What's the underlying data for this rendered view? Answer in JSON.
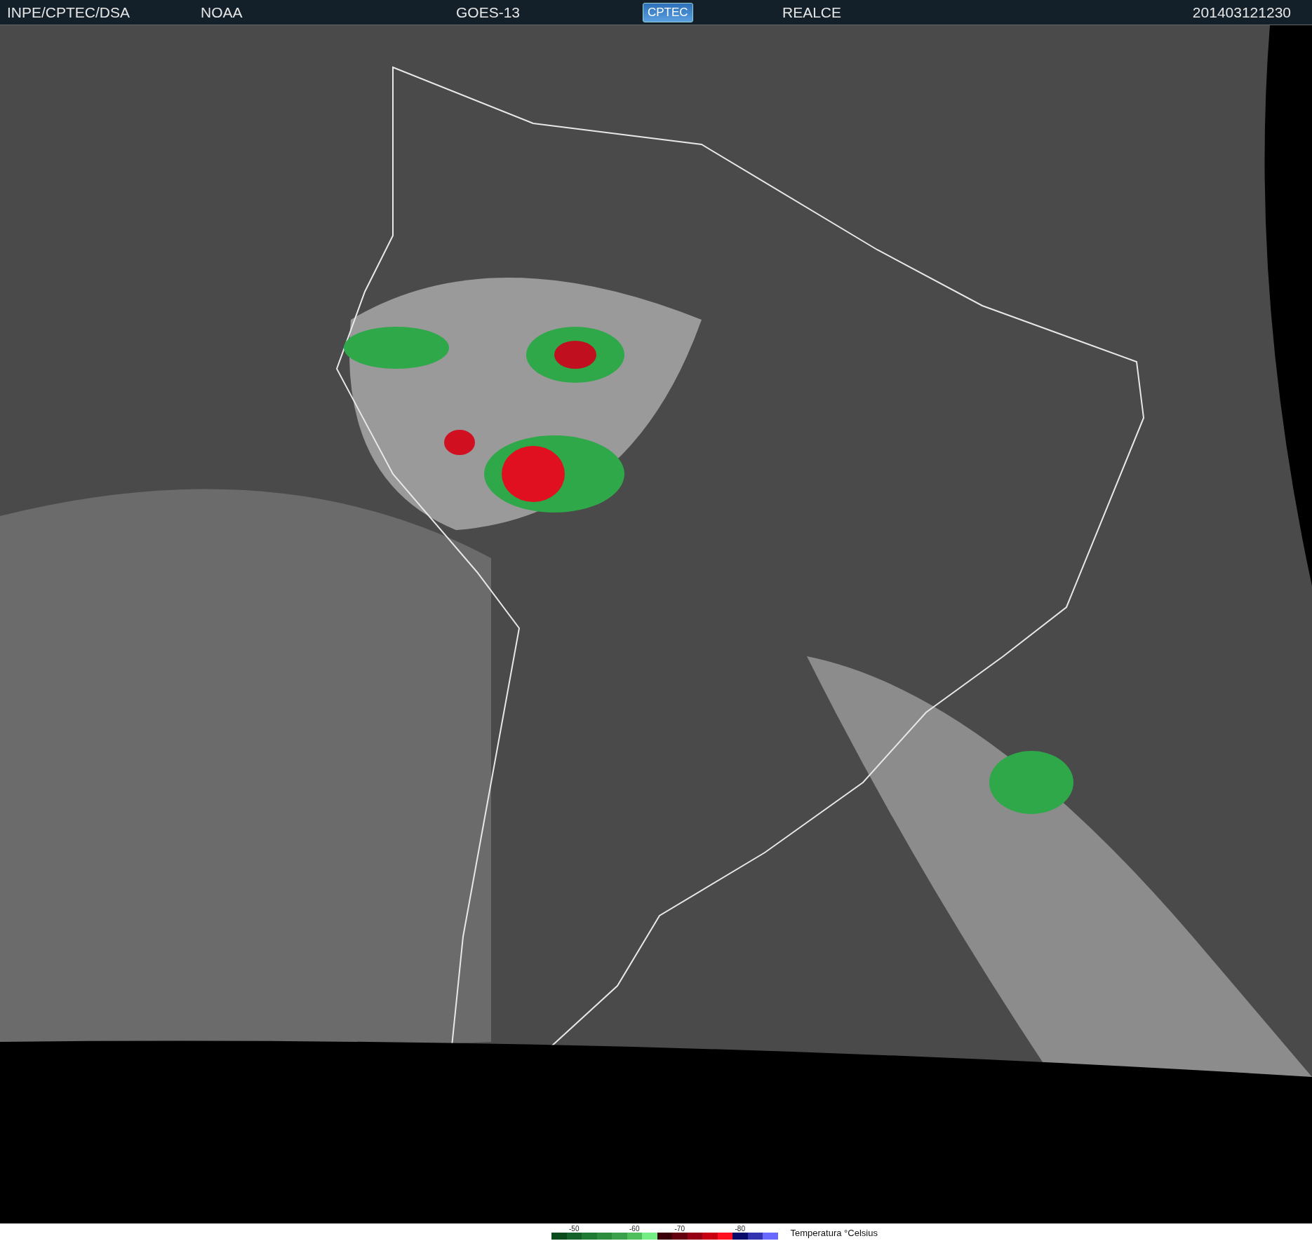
{
  "header": {
    "source": "INPE/CPTEC/DSA",
    "agency": "NOAA",
    "satellite": "GOES-13",
    "logo": "CPTEC",
    "product": "REALCE",
    "timestamp": "201403121230"
  },
  "legend": {
    "swatches": [
      {
        "color": "#0b4a1c"
      },
      {
        "color": "#15632a",
        "label": "-50"
      },
      {
        "color": "#1f7a33"
      },
      {
        "color": "#2b8c3e"
      },
      {
        "color": "#3aa04c"
      },
      {
        "color": "#4fbf5e",
        "label": "-60"
      },
      {
        "color": "#74ee84"
      },
      {
        "color": "#3a0008"
      },
      {
        "color": "#650010",
        "label": "-70"
      },
      {
        "color": "#950012"
      },
      {
        "color": "#c80010"
      },
      {
        "color": "#ff1020"
      },
      {
        "color": "#0a0a6a",
        "label": "-80"
      },
      {
        "color": "#3333b0"
      },
      {
        "color": "#6868ff"
      }
    ],
    "title": "Temperatura °Celsius"
  }
}
